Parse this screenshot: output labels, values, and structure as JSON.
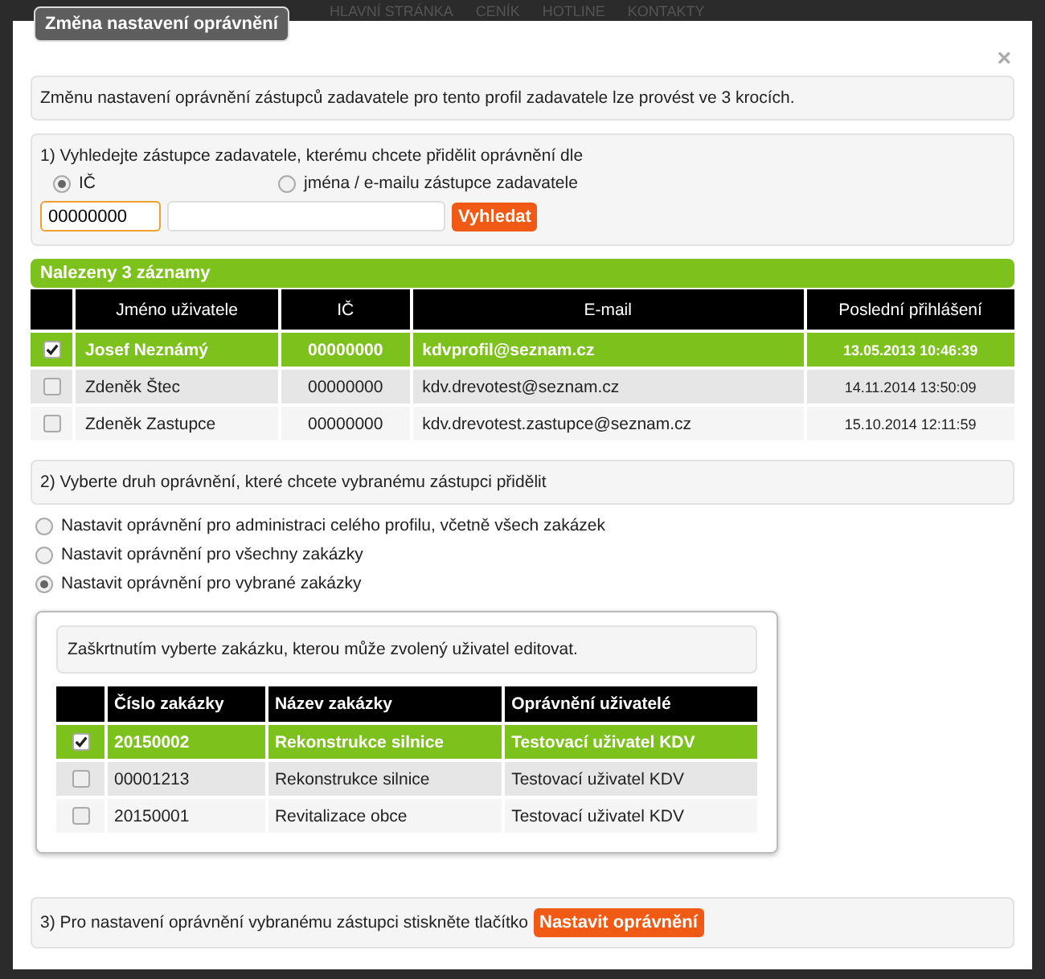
{
  "nav": [
    "HLAVNÍ STRÁNKA",
    "CENÍK",
    "HOTLINE",
    "KONTAKTY"
  ],
  "dialog": {
    "title": "Změna nastavení oprávnění",
    "close": "×"
  },
  "intro": "Změnu nastavení oprávnění zástupců zadavatele pro tento profil zadavatele lze provést ve 3 krocích.",
  "step1": {
    "label": "1) Vyhledejte zástupce zadavatele, kterému chcete přidělit oprávnění dle",
    "options": [
      {
        "label": "IČ",
        "selected": true
      },
      {
        "label": "jména / e-mailu zástupce zadavatele",
        "selected": false
      }
    ],
    "ic_value": "00000000",
    "button": "Vyhledat"
  },
  "results": {
    "title": "Nalezeny 3 záznamy",
    "columns": [
      "Jméno uživatele",
      "IČ",
      "E-mail",
      "Poslední přihlášení"
    ],
    "rows": [
      {
        "checked": true,
        "name": "Josef Neznámý",
        "ic": "00000000",
        "email": "kdvprofil@seznam.cz",
        "last_login": "13.05.2013 10:46:39"
      },
      {
        "checked": false,
        "name": "Zdeněk Štec",
        "ic": "00000000",
        "email": "kdv.drevotest@seznam.cz",
        "last_login": "14.11.2014 13:50:09"
      },
      {
        "checked": false,
        "name": "Zdeněk Zastupce",
        "ic": "00000000",
        "email": "kdv.drevotest.zastupce@seznam.cz",
        "last_login": "15.10.2014 12:11:59"
      }
    ]
  },
  "step2": {
    "label": "2) Vyberte druh oprávnění, které chcete vybranému zástupci přidělit",
    "options": [
      {
        "label": "Nastavit oprávnění pro administraci celého profilu, včetně všech zakázek",
        "selected": false
      },
      {
        "label": "Nastavit oprávnění pro všechny zakázky",
        "selected": false
      },
      {
        "label": "Nastavit oprávnění pro vybrané zakázky",
        "selected": true
      }
    ]
  },
  "contracts": {
    "note": "Zaškrtnutím vyberte zakázku, kterou může zvolený uživatel editovat.",
    "columns": [
      "Číslo zakázky",
      "Název zakázky",
      "Oprávnění uživatelé"
    ],
    "rows": [
      {
        "checked": true,
        "number": "20150002",
        "name": "Rekonstrukce silnice",
        "permission": "Testovací uživatel KDV"
      },
      {
        "checked": false,
        "number": "00001213",
        "name": "Rekonstrukce silnice",
        "permission": "Testovací uživatel KDV"
      },
      {
        "checked": false,
        "number": "20150001",
        "name": "Revitalizace obce",
        "permission": "Testovací uživatel KDV"
      }
    ]
  },
  "step3": {
    "text": "3) Pro nastavení oprávnění vybranému zástupci stiskněte tlačítko",
    "button": "Nastavit oprávnění"
  }
}
